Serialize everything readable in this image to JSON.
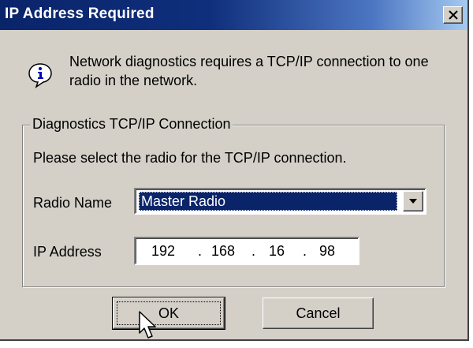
{
  "window": {
    "title": "IP Address Required",
    "close_label": "close"
  },
  "message": {
    "icon": "info-icon",
    "text": "Network diagnostics requires a TCP/IP connection to one radio in the network."
  },
  "group": {
    "label": "Diagnostics TCP/IP Connection",
    "instruction": "Please select the radio for the TCP/IP connection.",
    "radio_name_label": "Radio Name",
    "radio_name_value": "Master Radio",
    "ip_label": "IP Address",
    "ip_octets": [
      "192",
      "168",
      "16",
      "98"
    ]
  },
  "buttons": {
    "ok": "OK",
    "cancel": "Cancel"
  },
  "colors": {
    "titlebar_start": "#0a246a",
    "titlebar_end": "#a6caf0",
    "dialog_face": "#d4d0c8",
    "selection": "#0a246a"
  }
}
